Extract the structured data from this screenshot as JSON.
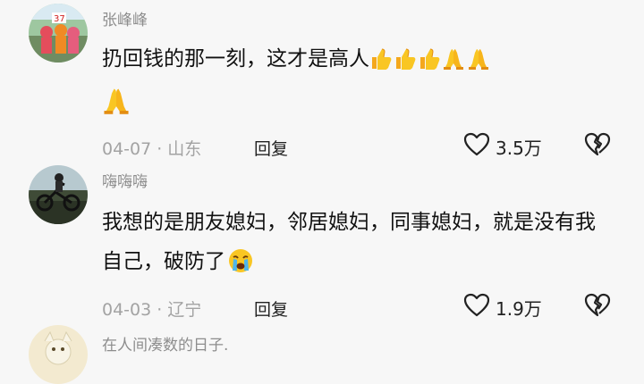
{
  "comments": [
    {
      "username": "张峰峰",
      "text": "扔回钱的那一刻，这才是高人",
      "emojis": [
        "thumbs-up",
        "thumbs-up",
        "thumbs-up",
        "pray",
        "pray",
        "pray"
      ],
      "date": "04-07",
      "location": "山东",
      "reply_label": "回复",
      "likes": "3.5万"
    },
    {
      "username": "嗨嗨嗨",
      "text": "我想的是朋友媳妇，邻居媳妇，同事媳妇，就是没有我自己，破防了",
      "emojis": [
        "crying-face"
      ],
      "date": "04-03",
      "location": "辽宁",
      "reply_label": "回复",
      "likes": "1.9万"
    },
    {
      "username": "在人间凑数的日子.",
      "text": "",
      "emojis": []
    }
  ],
  "meta_separator": "·",
  "colors": {
    "background": "#f7f7f7",
    "meta_gray": "#a3a3a3",
    "text": "#111111",
    "emoji_yellow": "#f9c623"
  }
}
